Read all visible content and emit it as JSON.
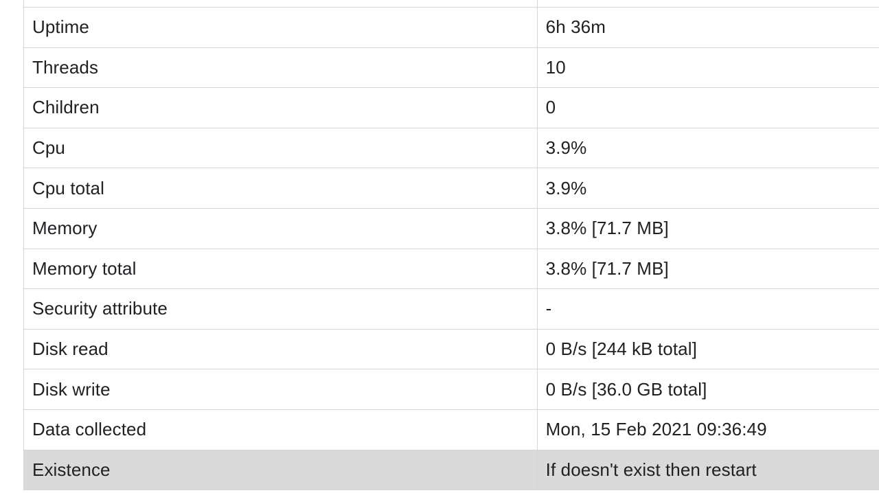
{
  "table": {
    "columns": [
      "property",
      "value"
    ],
    "rows": [
      {
        "property": "Uptime",
        "value": "6h 36m",
        "highlighted": false,
        "muted": false
      },
      {
        "property": "Threads",
        "value": "10",
        "highlighted": false,
        "muted": false
      },
      {
        "property": "Children",
        "value": "0",
        "highlighted": false,
        "muted": false
      },
      {
        "property": "Cpu",
        "value": "3.9%",
        "highlighted": false,
        "muted": false
      },
      {
        "property": "Cpu total",
        "value": "3.9%",
        "highlighted": false,
        "muted": false
      },
      {
        "property": "Memory",
        "value": "3.8% [71.7 MB]",
        "highlighted": false,
        "muted": false
      },
      {
        "property": "Memory total",
        "value": "3.8% [71.7 MB]",
        "highlighted": false,
        "muted": false
      },
      {
        "property": "Security attribute",
        "value": "-",
        "highlighted": false,
        "muted": true
      },
      {
        "property": "Disk read",
        "value": "0 B/s [244 kB total]",
        "highlighted": false,
        "muted": false
      },
      {
        "property": "Disk write",
        "value": "0 B/s [36.0 GB total]",
        "highlighted": false,
        "muted": false
      },
      {
        "property": "Data collected",
        "value": "Mon, 15 Feb 2021 09:36:49",
        "highlighted": false,
        "muted": false
      },
      {
        "property": "Existence",
        "value": "If doesn't exist then restart",
        "highlighted": true,
        "muted": false
      }
    ]
  },
  "colors": {
    "border": "#d6d6d6",
    "highlight_row_background": "#dadada",
    "text": "#202124",
    "muted_text": "#9a9a9a",
    "background": "#ffffff"
  }
}
